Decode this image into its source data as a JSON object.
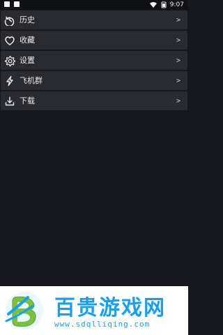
{
  "status_bar": {
    "time": "9:07"
  },
  "menu": {
    "items": [
      {
        "label": "历史",
        "icon": "history-icon",
        "chevron": ">"
      },
      {
        "label": "收藏",
        "icon": "heart-icon",
        "chevron": ">"
      },
      {
        "label": "设置",
        "icon": "gear-icon",
        "chevron": ">"
      },
      {
        "label": "飞机群",
        "icon": "lightning-icon",
        "chevron": ">"
      },
      {
        "label": "下载",
        "icon": "download-icon",
        "chevron": ">"
      }
    ]
  },
  "footer_ad": {
    "title": "百贵游戏网",
    "url": "www.sdqlliqing.com",
    "brand_color": "#1aa0e8",
    "logo_color": "#7ac143"
  }
}
